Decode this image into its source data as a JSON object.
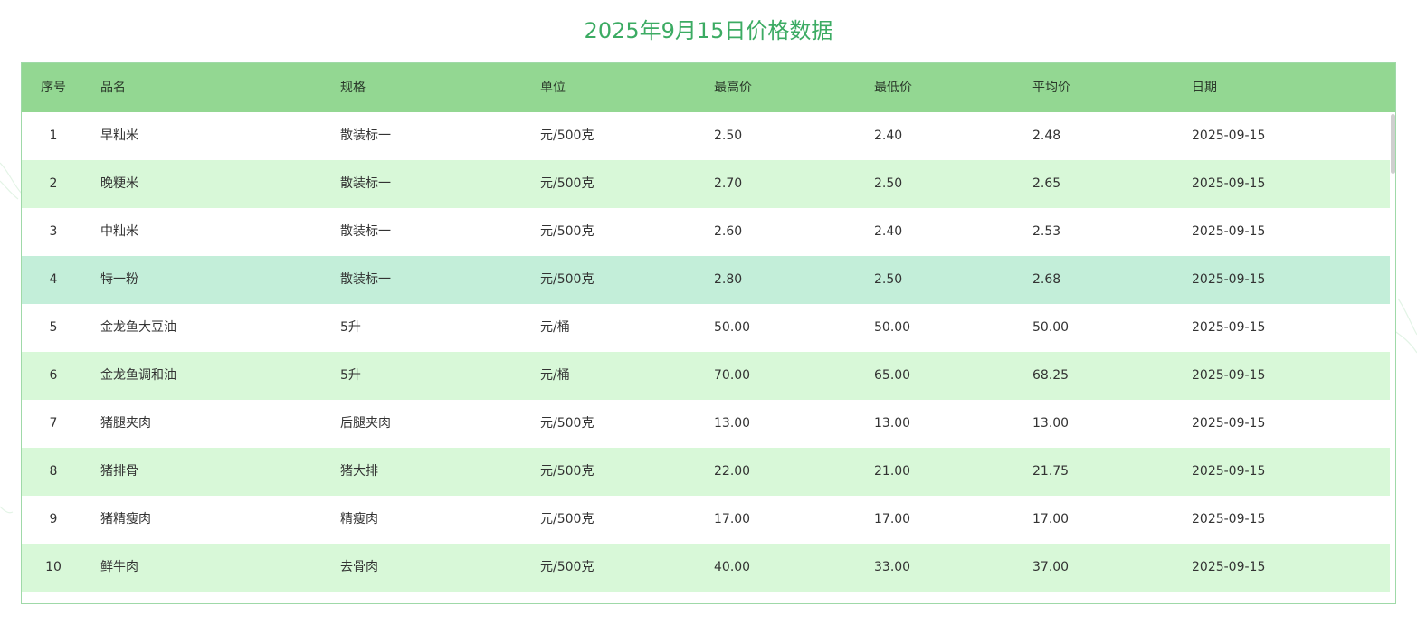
{
  "page_title": "2025年9月15日价格数据",
  "colors": {
    "title": "#3cab63",
    "header_bg": "#93d792",
    "row_alt": "#d8f8d8",
    "row_hover": "#c3eed9",
    "border": "#9fd9a8"
  },
  "table": {
    "columns": [
      "序号",
      "品名",
      "规格",
      "单位",
      "最高价",
      "最低价",
      "平均价",
      "日期"
    ],
    "rows": [
      [
        "1",
        "早籼米",
        "散装标一",
        "元/500克",
        "2.50",
        "2.40",
        "2.48",
        "2025-09-15"
      ],
      [
        "2",
        "晚粳米",
        "散装标一",
        "元/500克",
        "2.70",
        "2.50",
        "2.65",
        "2025-09-15"
      ],
      [
        "3",
        "中籼米",
        "散装标一",
        "元/500克",
        "2.60",
        "2.40",
        "2.53",
        "2025-09-15"
      ],
      [
        "4",
        "特一粉",
        "散装标一",
        "元/500克",
        "2.80",
        "2.50",
        "2.68",
        "2025-09-15"
      ],
      [
        "5",
        "金龙鱼大豆油",
        "5升",
        "元/桶",
        "50.00",
        "50.00",
        "50.00",
        "2025-09-15"
      ],
      [
        "6",
        "金龙鱼调和油",
        "5升",
        "元/桶",
        "70.00",
        "65.00",
        "68.25",
        "2025-09-15"
      ],
      [
        "7",
        "猪腿夹肉",
        "后腿夹肉",
        "元/500克",
        "13.00",
        "13.00",
        "13.00",
        "2025-09-15"
      ],
      [
        "8",
        "猪排骨",
        "猪大排",
        "元/500克",
        "22.00",
        "21.00",
        "21.75",
        "2025-09-15"
      ],
      [
        "9",
        "猪精瘦肉",
        "精瘦肉",
        "元/500克",
        "17.00",
        "17.00",
        "17.00",
        "2025-09-15"
      ],
      [
        "10",
        "鲜牛肉",
        "去骨肉",
        "元/500克",
        "40.00",
        "33.00",
        "37.00",
        "2025-09-15"
      ]
    ],
    "hover_row_index": 3
  }
}
